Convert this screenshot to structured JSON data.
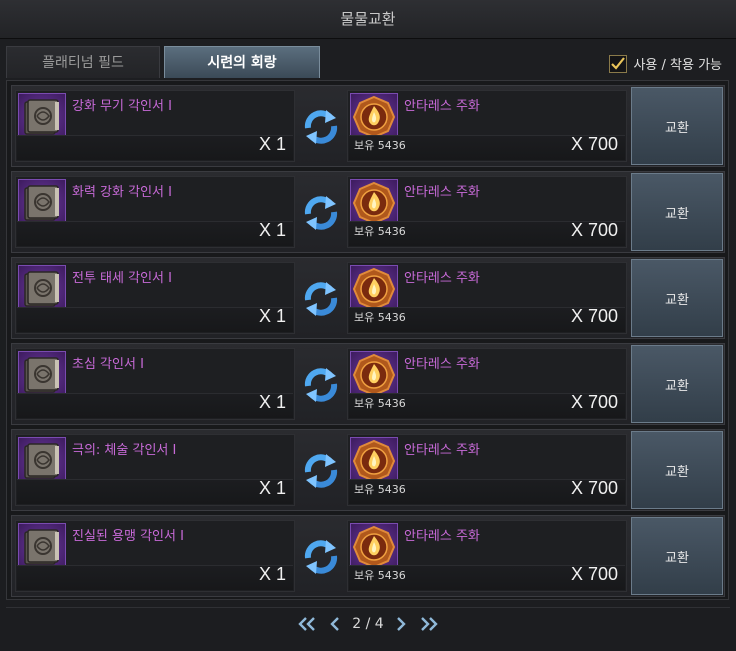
{
  "window": {
    "title": "물물교환"
  },
  "tabs": [
    {
      "label": "플래티넘 필드",
      "active": false
    },
    {
      "label": "시련의 회랑",
      "active": true
    }
  ],
  "filter": {
    "label": "사용 / 착용 가능",
    "checked": true
  },
  "rows": [
    {
      "give": {
        "name": "강화 무기 각인서 I",
        "qty": "X 1"
      },
      "get": {
        "name": "안타레스 주화",
        "owned": "보유 5436",
        "qty": "X 700"
      },
      "button": "교환"
    },
    {
      "give": {
        "name": "화력 강화 각인서 I",
        "qty": "X 1"
      },
      "get": {
        "name": "안타레스 주화",
        "owned": "보유 5436",
        "qty": "X 700"
      },
      "button": "교환"
    },
    {
      "give": {
        "name": "전투 태세 각인서 I",
        "qty": "X 1"
      },
      "get": {
        "name": "안타레스 주화",
        "owned": "보유 5436",
        "qty": "X 700"
      },
      "button": "교환"
    },
    {
      "give": {
        "name": "초심 각인서 I",
        "qty": "X 1"
      },
      "get": {
        "name": "안타레스 주화",
        "owned": "보유 5436",
        "qty": "X 700"
      },
      "button": "교환"
    },
    {
      "give": {
        "name": "극의: 체술 각인서 I",
        "qty": "X 1"
      },
      "get": {
        "name": "안타레스 주화",
        "owned": "보유 5436",
        "qty": "X 700"
      },
      "button": "교환"
    },
    {
      "give": {
        "name": "진실된 용맹 각인서 I",
        "qty": "X 1"
      },
      "get": {
        "name": "안타레스 주화",
        "owned": "보유 5436",
        "qty": "X 700"
      },
      "button": "교환"
    }
  ],
  "pager": {
    "text": "2 / 4",
    "current": 2,
    "total": 4
  },
  "icons": {
    "engraving_book": "engraving-book-icon",
    "coin": "antares-coin-icon",
    "swap": "swap-arrows-icon"
  },
  "colors": {
    "item_name": "#c86ad8",
    "icon_bg": "#5a2f88",
    "active_tab": "#4b5d6c",
    "swap_arrow": "#4fa8f0"
  }
}
